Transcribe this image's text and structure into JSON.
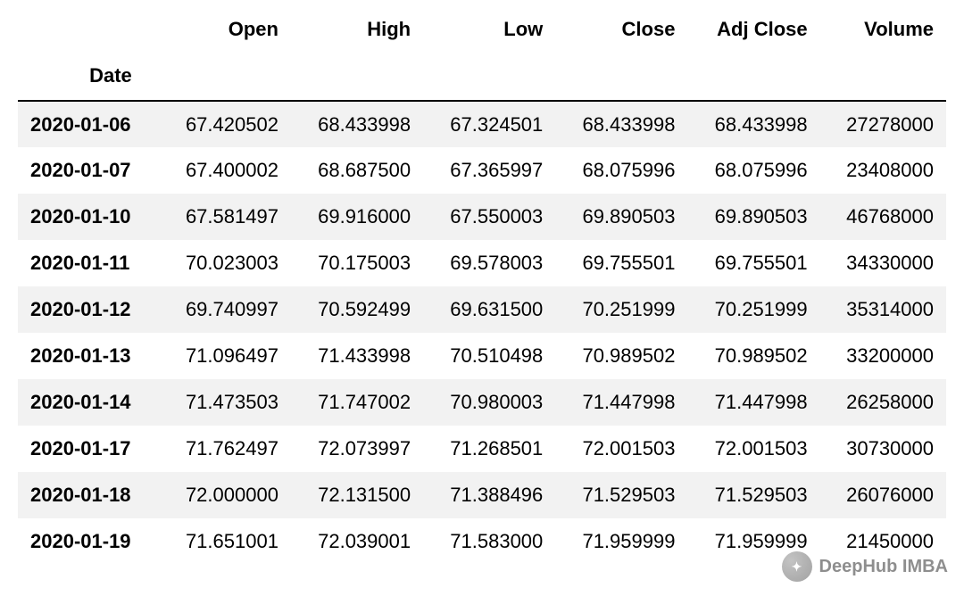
{
  "table": {
    "index_name": "Date",
    "columns": [
      "Open",
      "High",
      "Low",
      "Close",
      "Adj Close",
      "Volume"
    ],
    "rows": [
      {
        "date": "2020-01-06",
        "open": "67.420502",
        "high": "68.433998",
        "low": "67.324501",
        "close": "68.433998",
        "adj": "68.433998",
        "volume": "27278000"
      },
      {
        "date": "2020-01-07",
        "open": "67.400002",
        "high": "68.687500",
        "low": "67.365997",
        "close": "68.075996",
        "adj": "68.075996",
        "volume": "23408000"
      },
      {
        "date": "2020-01-10",
        "open": "67.581497",
        "high": "69.916000",
        "low": "67.550003",
        "close": "69.890503",
        "adj": "69.890503",
        "volume": "46768000"
      },
      {
        "date": "2020-01-11",
        "open": "70.023003",
        "high": "70.175003",
        "low": "69.578003",
        "close": "69.755501",
        "adj": "69.755501",
        "volume": "34330000"
      },
      {
        "date": "2020-01-12",
        "open": "69.740997",
        "high": "70.592499",
        "low": "69.631500",
        "close": "70.251999",
        "adj": "70.251999",
        "volume": "35314000"
      },
      {
        "date": "2020-01-13",
        "open": "71.096497",
        "high": "71.433998",
        "low": "70.510498",
        "close": "70.989502",
        "adj": "70.989502",
        "volume": "33200000"
      },
      {
        "date": "2020-01-14",
        "open": "71.473503",
        "high": "71.747002",
        "low": "70.980003",
        "close": "71.447998",
        "adj": "71.447998",
        "volume": "26258000"
      },
      {
        "date": "2020-01-17",
        "open": "71.762497",
        "high": "72.073997",
        "low": "71.268501",
        "close": "72.001503",
        "adj": "72.001503",
        "volume": "30730000"
      },
      {
        "date": "2020-01-18",
        "open": "72.000000",
        "high": "72.131500",
        "low": "71.388496",
        "close": "71.529503",
        "adj": "71.529503",
        "volume": "26076000"
      },
      {
        "date": "2020-01-19",
        "open": "71.651001",
        "high": "72.039001",
        "low": "71.583000",
        "close": "71.959999",
        "adj": "71.959999",
        "volume": "21450000"
      }
    ]
  },
  "watermark": {
    "text": "DeepHub IMBA"
  },
  "chart_data": {
    "type": "table",
    "title": "",
    "index_name": "Date",
    "columns": [
      "Open",
      "High",
      "Low",
      "Close",
      "Adj Close",
      "Volume"
    ],
    "index": [
      "2020-01-06",
      "2020-01-07",
      "2020-01-10",
      "2020-01-11",
      "2020-01-12",
      "2020-01-13",
      "2020-01-14",
      "2020-01-17",
      "2020-01-18",
      "2020-01-19"
    ],
    "data": [
      [
        67.420502,
        68.433998,
        67.324501,
        68.433998,
        68.433998,
        27278000
      ],
      [
        67.400002,
        68.6875,
        67.365997,
        68.075996,
        68.075996,
        23408000
      ],
      [
        67.581497,
        69.916,
        67.550003,
        69.890503,
        69.890503,
        46768000
      ],
      [
        70.023003,
        70.175003,
        69.578003,
        69.755501,
        69.755501,
        34330000
      ],
      [
        69.740997,
        70.592499,
        69.6315,
        70.251999,
        70.251999,
        35314000
      ],
      [
        71.096497,
        71.433998,
        70.510498,
        70.989502,
        70.989502,
        33200000
      ],
      [
        71.473503,
        71.747002,
        70.980003,
        71.447998,
        71.447998,
        26258000
      ],
      [
        71.762497,
        72.073997,
        71.268501,
        72.001503,
        72.001503,
        30730000
      ],
      [
        72.0,
        72.1315,
        71.388496,
        71.529503,
        71.529503,
        26076000
      ],
      [
        71.651001,
        72.039001,
        71.583,
        71.959999,
        71.959999,
        21450000
      ]
    ]
  }
}
